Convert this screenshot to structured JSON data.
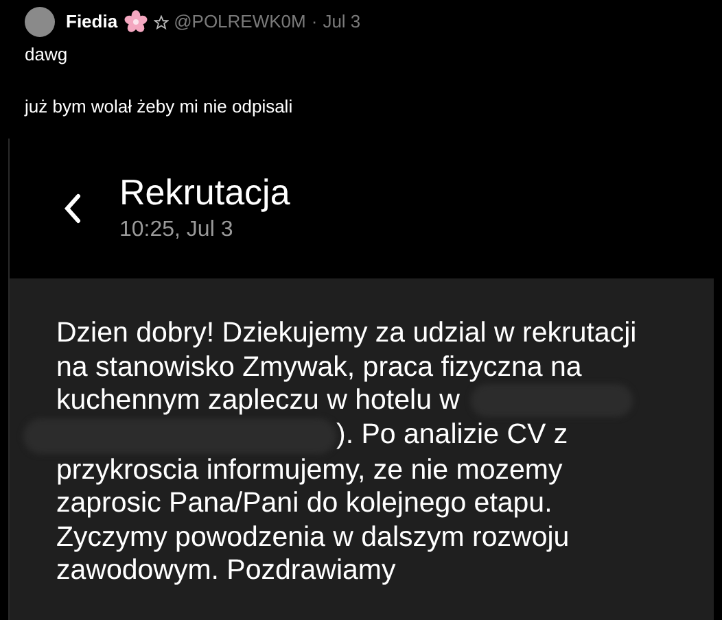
{
  "post": {
    "author": "Fiedia",
    "handle": "@POLREWK0M",
    "separator": "·",
    "date": "Jul 3",
    "paragraphs": [
      "dawg",
      "już bym wolał żeby mi nie odpisali"
    ]
  },
  "screenshot": {
    "title": "Rekrutacja",
    "time": "10:25, Jul 3",
    "message_lines": [
      {
        "text": "Dzien dobry! Dziekujemy za udzial w rekrutacji",
        "redacted_before": false,
        "redacted_after": false
      },
      {
        "text": "na stanowisko Zmywak, praca fizyczna na",
        "redacted_before": false,
        "redacted_after": false
      },
      {
        "text": "kuchennym zapleczu w hotelu w",
        "redacted_before": false,
        "redacted_after": true
      },
      {
        "text": "). Po analizie CV z",
        "redacted_before": true,
        "redacted_after": false
      },
      {
        "text": "przykroscia informujemy, ze nie mozemy",
        "redacted_before": false,
        "redacted_after": false
      },
      {
        "text": "zaprosic Pana/Pani do kolejnego etapu.",
        "redacted_before": false,
        "redacted_after": false
      },
      {
        "text": "Zyczymy powodzenia w dalszym rozwoju",
        "redacted_before": false,
        "redacted_after": false
      },
      {
        "text": "zawodowym. Pozdrawiamy",
        "redacted_before": false,
        "redacted_after": false
      }
    ]
  }
}
